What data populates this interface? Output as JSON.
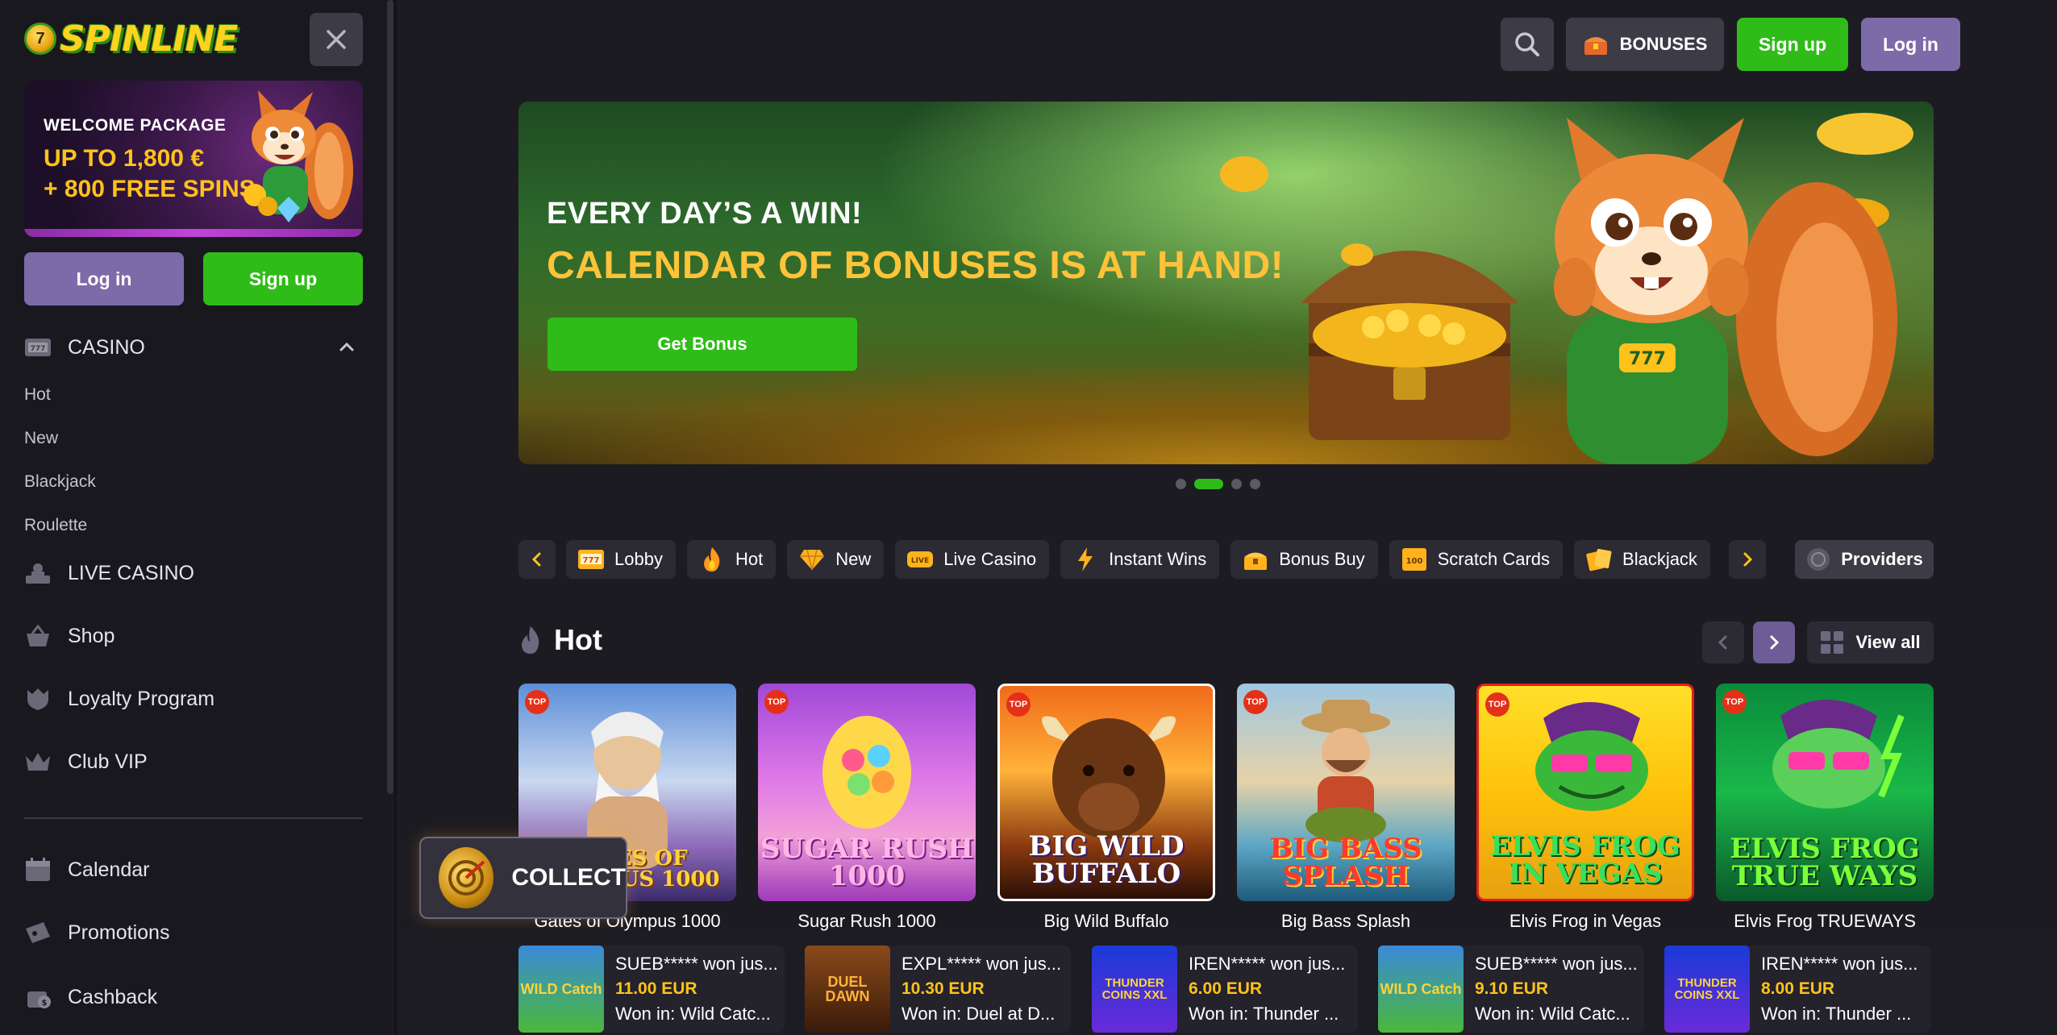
{
  "brand": {
    "logo_text": "SPINLINE"
  },
  "sidebar": {
    "promo": {
      "line1": "WELCOME PACKAGE",
      "line2": "UP TO 1,800 €",
      "line3": "+ 800 FREE SPINS"
    },
    "login_label": "Log in",
    "signup_label": "Sign up",
    "casino": {
      "label": "CASINO",
      "expanded": true,
      "sub_items": [
        "Hot",
        "New",
        "Blackjack",
        "Roulette"
      ]
    },
    "nav": [
      {
        "label": "LIVE CASINO",
        "icon": "dealer-icon"
      },
      {
        "label": "Shop",
        "icon": "basket-icon"
      },
      {
        "label": "Loyalty Program",
        "icon": "shield-crown-icon"
      },
      {
        "label": "Club VIP",
        "icon": "crown-icon"
      }
    ],
    "nav2": [
      {
        "label": "Calendar",
        "icon": "calendar-icon"
      },
      {
        "label": "Promotions",
        "icon": "ticket-icon"
      },
      {
        "label": "Cashback",
        "icon": "cashback-icon"
      }
    ]
  },
  "collect": {
    "label": "COLLECT"
  },
  "header": {
    "bonuses_label": "BONUSES",
    "signup_label": "Sign up",
    "login_label": "Log in"
  },
  "banner": {
    "title1": "EVERY DAY’S A WIN!",
    "title2": "CALENDAR OF BONUSES IS AT HAND!",
    "button_label": "Get Bonus",
    "slide_count": 4,
    "active_slide": 1
  },
  "categories": {
    "tabs": [
      {
        "label": "Lobby",
        "icon": "slot-777-icon"
      },
      {
        "label": "Hot",
        "icon": "flame-icon"
      },
      {
        "label": "New",
        "icon": "diamond-icon"
      },
      {
        "label": "Live Casino",
        "icon": "live-icon"
      },
      {
        "label": "Instant Wins",
        "icon": "lightning-icon"
      },
      {
        "label": "Bonus Buy",
        "icon": "chest-icon"
      },
      {
        "label": "Scratch Cards",
        "icon": "scratch-card-icon"
      },
      {
        "label": "Blackjack",
        "icon": "cards-icon"
      }
    ],
    "providers_label": "Providers"
  },
  "hot": {
    "title": "Hot",
    "view_all_label": "View all",
    "badge": "TOP",
    "games": [
      {
        "name": "Gates of Olympus 1000",
        "logo": "GATES OF OLYMPUS 1000"
      },
      {
        "name": "Sugar Rush 1000",
        "logo": "SUGAR RUSH 1000"
      },
      {
        "name": "Big Wild Buffalo",
        "logo": "BIG WILD BUFFALO"
      },
      {
        "name": "Big Bass Splash",
        "logo": "BIG BASS SPLASH"
      },
      {
        "name": "Elvis Frog in Vegas",
        "logo": "ELVIS FROG IN VEGAS"
      },
      {
        "name": "Elvis Frog TRUEWAYS",
        "logo": "ELVIS FROG TRUE WAYS"
      }
    ]
  },
  "winners": [
    {
      "user": "SUEB***** won jus...",
      "amount": "11.00 EUR",
      "game": "Won in: Wild Catc...",
      "thumb": "WILD Catch"
    },
    {
      "user": "EXPL***** won jus...",
      "amount": "10.30 EUR",
      "game": "Won in: Duel at D...",
      "thumb": "DUEL DAWN"
    },
    {
      "user": "IREN***** won jus...",
      "amount": "6.00 EUR",
      "game": "Won in: Thunder ...",
      "thumb": "THUNDER COINS XXL"
    },
    {
      "user": "SUEB***** won jus...",
      "amount": "9.10 EUR",
      "game": "Won in: Wild Catc...",
      "thumb": "WILD Catch"
    },
    {
      "user": "IREN***** won jus...",
      "amount": "8.00 EUR",
      "game": "Won in: Thunder ...",
      "thumb": "THUNDER COINS XXL"
    }
  ],
  "colors": {
    "bg": "#1d1b22",
    "sidebar": "#1a181f",
    "accent_green": "#2fbc18",
    "accent_purple": "#7d6aa9",
    "gold": "#ffc21c",
    "top_badge": "#e53019"
  }
}
